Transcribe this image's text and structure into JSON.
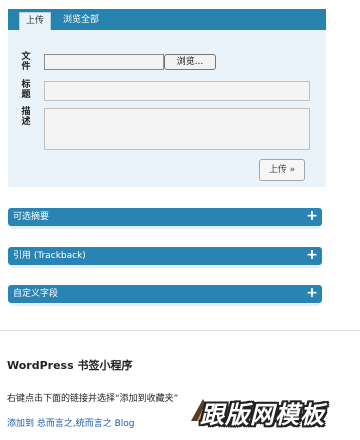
{
  "upload": {
    "tabs": [
      {
        "label": "上传",
        "active": true
      },
      {
        "label": "浏览全部",
        "active": false
      }
    ],
    "fields": {
      "file_label": "文件",
      "title_label": "标题",
      "description_label": "描述"
    },
    "file_value": "",
    "title_value": "",
    "description_value": "",
    "browse_label": "浏览...",
    "submit_label": "上传 »"
  },
  "boxes": [
    {
      "title": "可选摘要",
      "toggle": "+"
    },
    {
      "title": "引用 (Trackback)",
      "toggle": "+"
    },
    {
      "title": "自定义字段",
      "toggle": "+"
    }
  ],
  "bookmarklet": {
    "heading": "WordPress 书签小程序",
    "instructions": "右键点击下面的链接并选择“添加到收藏夹”",
    "link": "添加到 总而言之,统而言之 Blog"
  },
  "watermark": {
    "text": "跟版网模板"
  },
  "colors": {
    "accent_blue": "#2683ae",
    "panel_bg": "#eaf3fa",
    "link": "#1a5aa8"
  }
}
